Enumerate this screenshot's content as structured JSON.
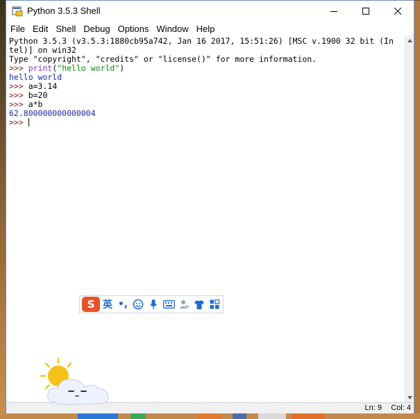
{
  "window": {
    "title": "Python 3.5.3 Shell",
    "colors": {
      "prompt": "#7a1f1f",
      "output": "#1a2aa8",
      "string": "#0a8a0a",
      "builtin": "#8a2be2"
    }
  },
  "menu": [
    {
      "label": "File"
    },
    {
      "label": "Edit"
    },
    {
      "label": "Shell"
    },
    {
      "label": "Debug"
    },
    {
      "label": "Options"
    },
    {
      "label": "Window"
    },
    {
      "label": "Help"
    }
  ],
  "shell": {
    "banner_1": "Python 3.5.3 (v3.5.3:1880cb95a742, Jan 16 2017, 15:51:26) [MSC v.1900 32 bit (In",
    "banner_2": "tel)] on win32",
    "banner_3": "Type \"copyright\", \"credits\" or \"license()\" for more information.",
    "prompt": ">>> ",
    "cmd1_fn": "print",
    "cmd1_open": "(",
    "cmd1_str": "\"hello world\"",
    "cmd1_close": ")",
    "out1": "hello world",
    "cmd2": "a=3.14",
    "cmd3": "b=20",
    "cmd4": "a*b",
    "out4": "62.800000000000004",
    "final_prompt": ">>> "
  },
  "status": {
    "ln": "Ln: 9",
    "col": "Col: 4"
  },
  "ime": {
    "logo": "S",
    "mode": "英",
    "punct": "•,"
  }
}
